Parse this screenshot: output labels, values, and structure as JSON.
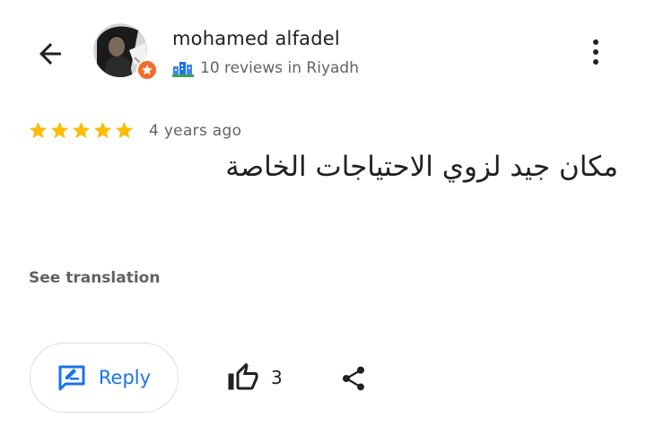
{
  "header": {
    "reviewer_name": "mohamed alfadel",
    "reviewer_meta": "10 reviews in Riyadh",
    "icons": {
      "back": "back-arrow-icon",
      "badge": "local-guide-star-icon",
      "city": "city-buildings-icon",
      "more": "more-vertical-icon"
    }
  },
  "review": {
    "rating": 5,
    "rating_max": 5,
    "time_ago": "4 years ago",
    "text": "مكان جيد لزوي الاحتياجات الخاصة",
    "see_translation_label": "See translation"
  },
  "actions": {
    "reply_label": "Reply",
    "like_count": "3",
    "icons": {
      "reply": "reply-edit-icon",
      "like": "thumbs-up-icon",
      "share": "share-icon"
    }
  },
  "colors": {
    "star": "#fbbc04",
    "accent": "#1a73e8",
    "badge": "#f06e2b",
    "secondary_text": "#5f6368"
  }
}
